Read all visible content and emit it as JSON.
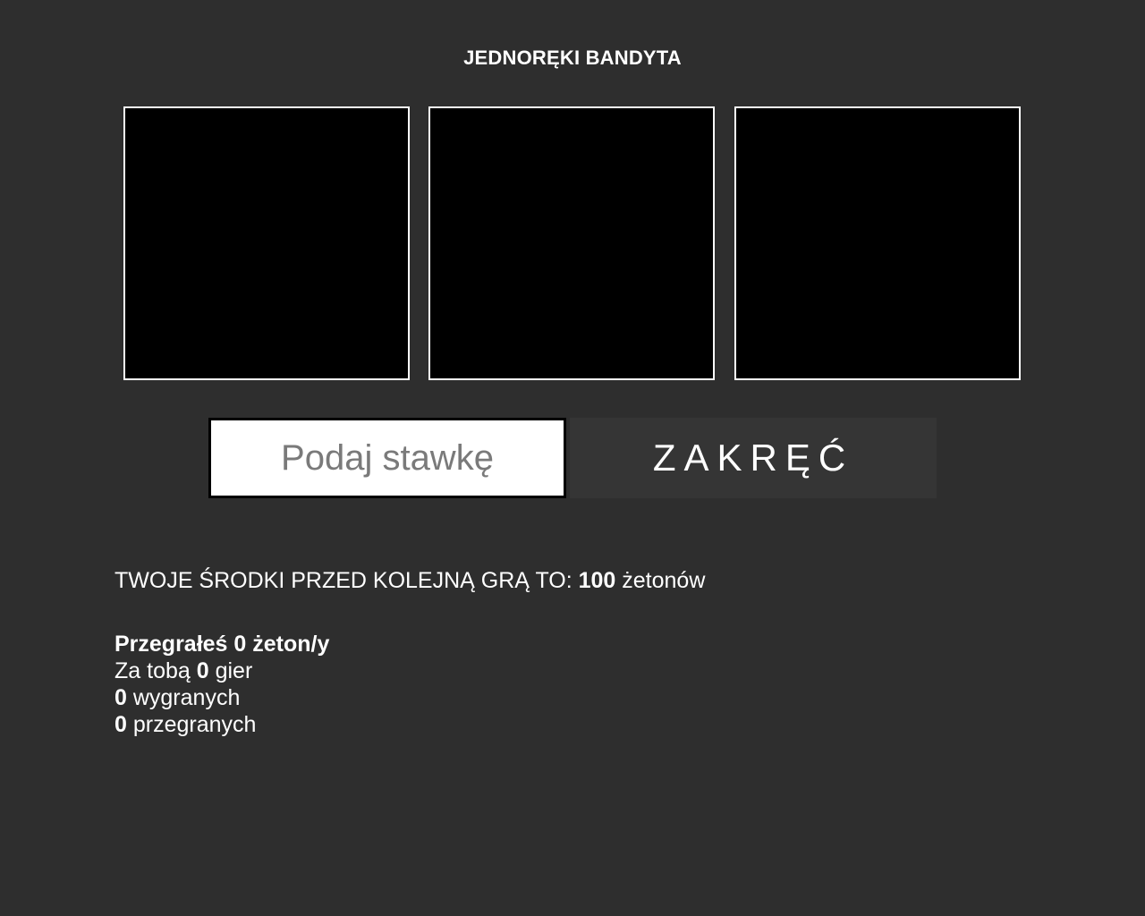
{
  "title": "JEDNORĘKI BANDYTA",
  "reels": [
    "",
    "",
    ""
  ],
  "bet": {
    "placeholder": "Podaj stawkę",
    "value": ""
  },
  "spin_label": "ZAKRĘĆ",
  "funds": {
    "prefix": "TWOJE ŚRODKI PRZED KOLEJNĄ GRĄ TO: ",
    "amount": "100",
    "suffix": " żetonów"
  },
  "stats": {
    "result_line": "Przegrałeś 0 żeton/y",
    "games_prefix": "Za tobą ",
    "games_count": "0",
    "games_suffix": " gier",
    "wins_count": "0",
    "wins_label": " wygranych",
    "losses_count": "0",
    "losses_label": " przegranych"
  },
  "colors": {
    "background": "#2e2e2e",
    "reel": "#000000",
    "reel_border": "#ffffff",
    "button": "#353535"
  }
}
